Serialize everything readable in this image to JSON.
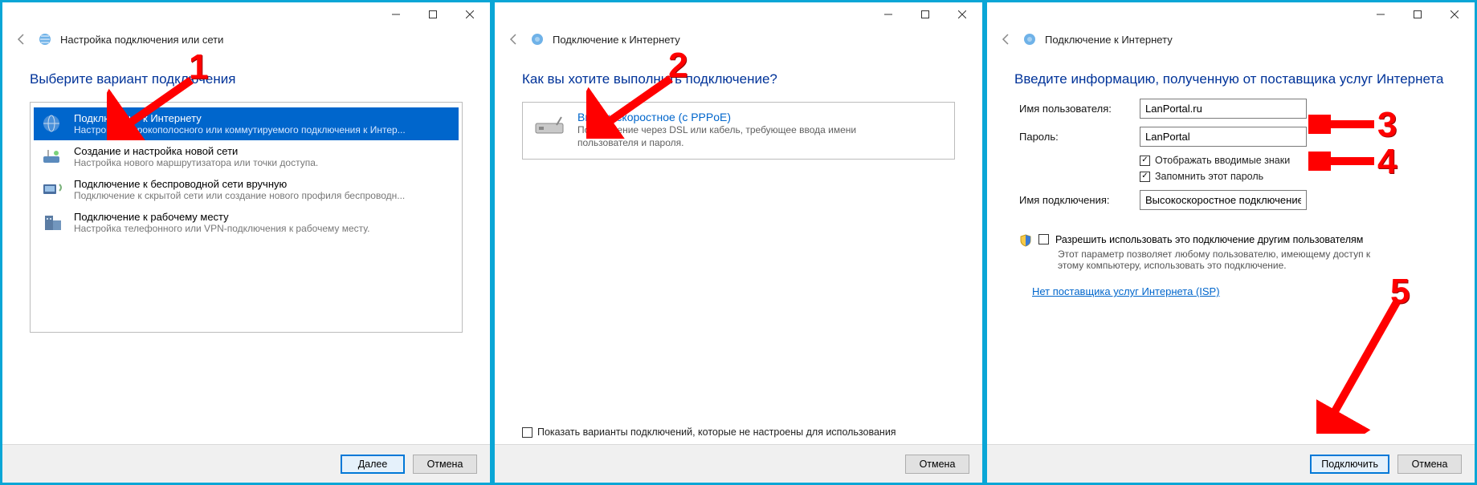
{
  "panel1": {
    "header_title": "Настройка подключения или сети",
    "prompt": "Выберите вариант подключения",
    "options": [
      {
        "title": "Подключение к Интернету",
        "desc": "Настройка широкополосного или коммутируемого подключения к Интер...",
        "selected": true
      },
      {
        "title": "Создание и настройка новой сети",
        "desc": "Настройка нового маршрутизатора или точки доступа."
      },
      {
        "title": "Подключение к беспроводной сети вручную",
        "desc": "Подключение к скрытой сети или создание нового профиля беспроводн..."
      },
      {
        "title": "Подключение к рабочему месту",
        "desc": "Настройка телефонного или VPN-подключения к рабочему месту."
      }
    ],
    "next_btn": "Далее",
    "cancel_btn": "Отмена",
    "anno_num": "1"
  },
  "panel2": {
    "header_title": "Подключение к Интернету",
    "prompt": "Как вы хотите выполнить подключение?",
    "option_title": "Высокоскоростное (с PPPoE)",
    "option_desc": "Подключение через DSL или кабель, требующее ввода имени пользователя и пароля.",
    "show_extra": "Показать варианты подключений, которые не настроены для использования",
    "cancel_btn": "Отмена",
    "anno_num": "2"
  },
  "panel3": {
    "header_title": "Подключение к Интернету",
    "prompt": "Введите информацию, полученную от поставщика услуг Интернета",
    "user_label": "Имя пользователя:",
    "user_value": "LanPortal.ru",
    "pass_label": "Пароль:",
    "pass_value": "LanPortal",
    "show_chars": "Отображать вводимые знаки",
    "remember": "Запомнить этот пароль",
    "conn_label": "Имя подключения:",
    "conn_value": "Высокоскоростное подключение",
    "permit_label": "Разрешить использовать это подключение другим пользователям",
    "permit_desc": "Этот параметр позволяет любому пользователю, имеющему доступ к этому компьютеру, использовать это подключение.",
    "isp_link": "Нет поставщика услуг Интернета (ISP)",
    "connect_btn": "Подключить",
    "cancel_btn": "Отмена",
    "anno3": "3",
    "anno4": "4",
    "anno5": "5"
  }
}
